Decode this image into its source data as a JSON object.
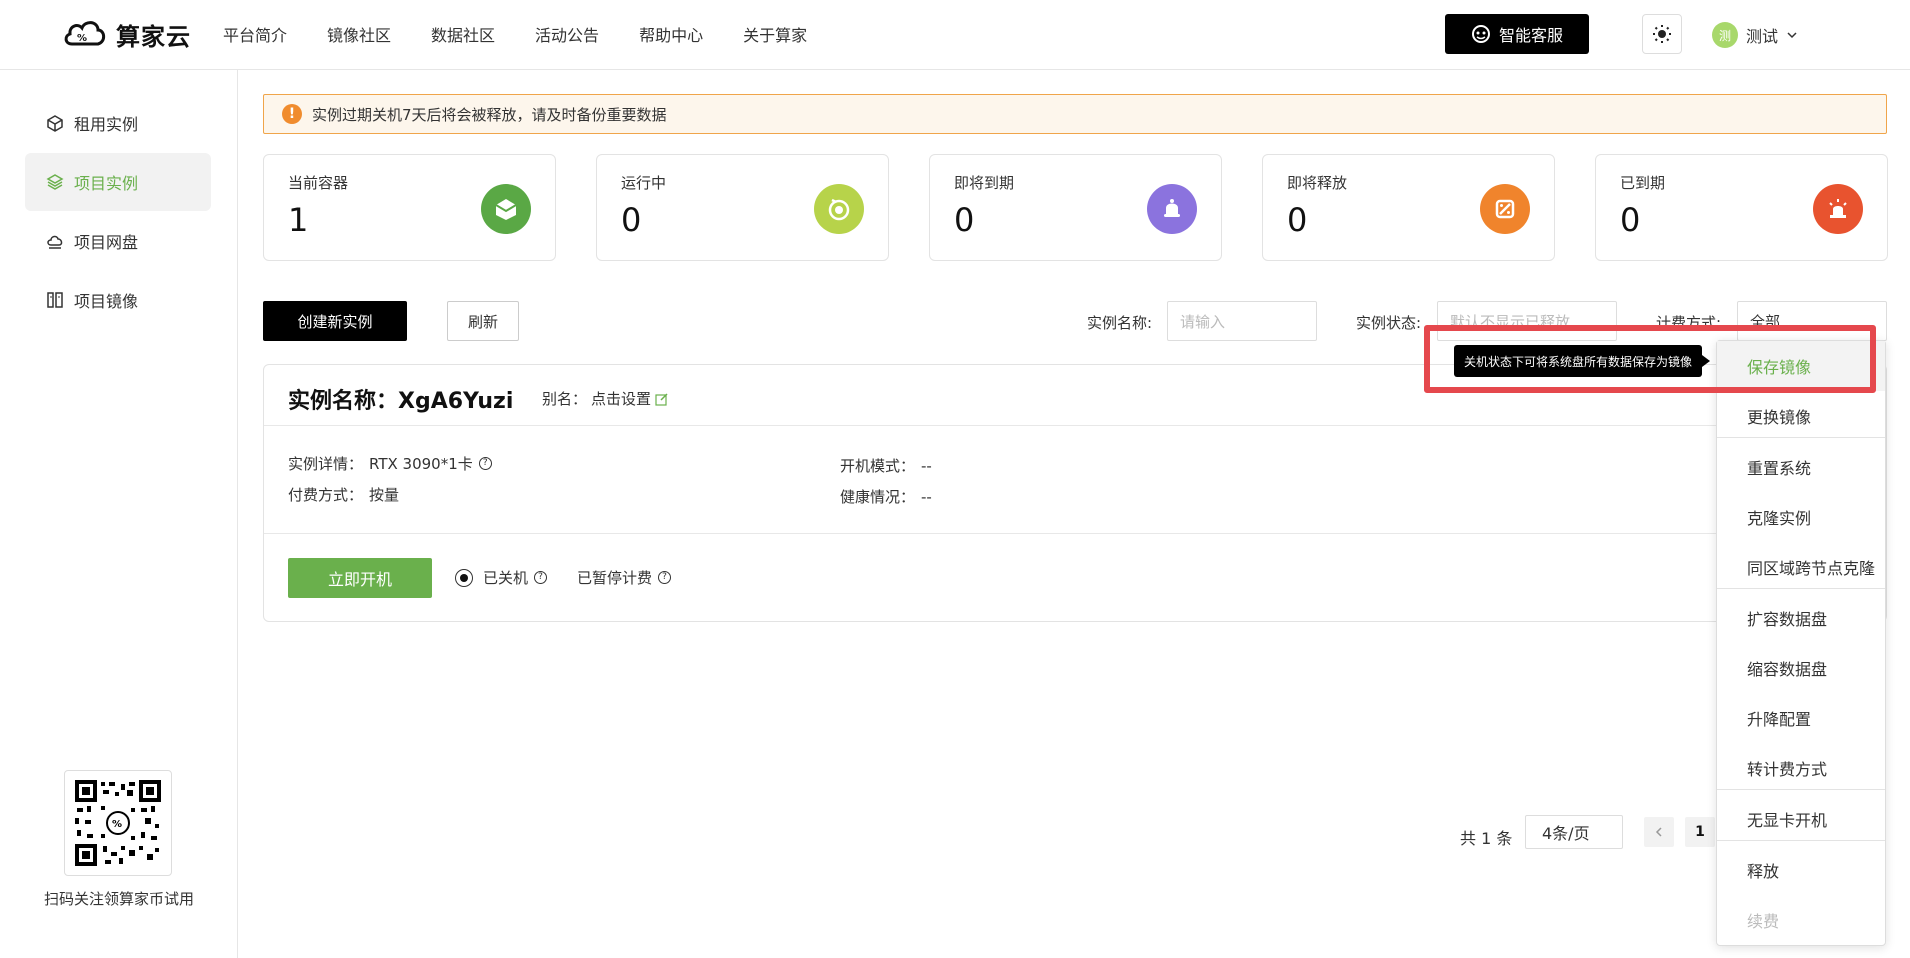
{
  "brand": {
    "name": "算家云"
  },
  "nav": [
    "平台简介",
    "镜像社区",
    "数据社区",
    "活动公告",
    "帮助中心",
    "关于算家"
  ],
  "header": {
    "service_label": "智能客服",
    "user_initial": "测",
    "user_name": "测试"
  },
  "sidebar": {
    "items": [
      {
        "label": "租用实例"
      },
      {
        "label": "项目实例"
      },
      {
        "label": "项目网盘"
      },
      {
        "label": "项目镜像"
      }
    ],
    "qr_caption": "扫码关注领算家币试用"
  },
  "alert": {
    "text": "实例过期关机7天后将会被释放，请及时备份重要数据"
  },
  "stats": [
    {
      "label": "当前容器",
      "value": "1",
      "color": "#5aa845"
    },
    {
      "label": "运行中",
      "value": "0",
      "color": "#b7d34a"
    },
    {
      "label": "即将到期",
      "value": "0",
      "color": "#8b73de"
    },
    {
      "label": "即将释放",
      "value": "0",
      "color": "#f0842c"
    },
    {
      "label": "已到期",
      "value": "0",
      "color": "#e8532f"
    }
  ],
  "toolbar": {
    "create_label": "创建新实例",
    "refresh_label": "刷新"
  },
  "filters": {
    "name_label": "实例名称:",
    "name_placeholder": "请输入",
    "status_label": "实例状态:",
    "status_value": "默认不显示已释放",
    "billing_label": "计费方式:",
    "billing_value": "全部"
  },
  "instance": {
    "title": "实例名称：XgA6Yuzi",
    "alias_label": "别名：",
    "alias_value": "点击设置",
    "detail_label": "实例详情：",
    "detail_value": "RTX 3090*1卡",
    "pay_label": "付费方式：",
    "pay_value": "按量",
    "boot_label": "开机模式：",
    "boot_value": "--",
    "health_label": "健康情况：",
    "health_value": "--",
    "start_label": "立即开机",
    "status_text": "已关机",
    "billing_text": "已暂停计费"
  },
  "pager": {
    "total": "共 1 条",
    "size": "4条/页",
    "current": "1"
  },
  "menu": {
    "tooltip": "关机状态下可将系统盘所有数据保存为镜像",
    "items": [
      "保存镜像",
      "更换镜像",
      "重置系统",
      "克隆实例",
      "同区域跨节点克隆",
      "扩容数据盘",
      "缩容数据盘",
      "升降配置",
      "转计费方式",
      "无显卡开机",
      "释放",
      "续费"
    ]
  },
  "colors": {
    "accent": "#6ab04c",
    "highlight": "#e5484d"
  }
}
